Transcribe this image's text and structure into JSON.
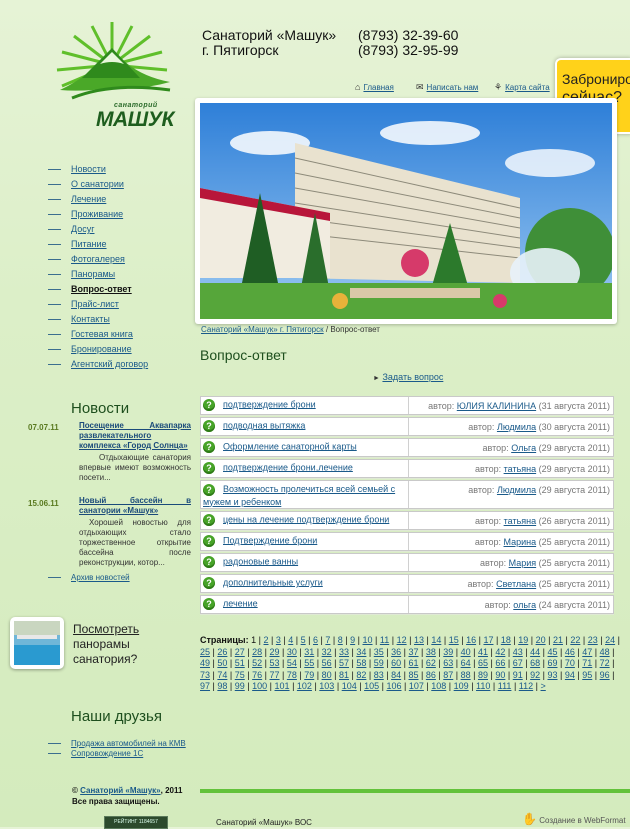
{
  "colors": {
    "accent_green": "#47a328",
    "link": "#1a5a8a",
    "badge": "#ffd21a"
  },
  "logo": {
    "small": "санаторий",
    "big": "МАШУК"
  },
  "header": {
    "name": "Санаторий «Машук»",
    "city": "г. Пятигорск",
    "phone1": "(8793) 32-39-60",
    "phone2": "(8793) 32-95-99"
  },
  "topnav": [
    {
      "label": "Главная",
      "icon": "home-icon"
    },
    {
      "label": "Написать нам",
      "icon": "envelope-icon"
    },
    {
      "label": "Карта сайта",
      "icon": "sitemap-icon"
    }
  ],
  "booking": {
    "line1": "Забронировать",
    "line2": "сейчас?"
  },
  "nav": [
    {
      "label": "Новости"
    },
    {
      "label": "О санатории"
    },
    {
      "label": "Лечение"
    },
    {
      "label": "Проживание"
    },
    {
      "label": "Досуг"
    },
    {
      "label": "Питание"
    },
    {
      "label": "Фотогалерея"
    },
    {
      "label": "Панорамы"
    },
    {
      "label": "Вопрос-ответ",
      "active": true
    },
    {
      "label": "Прайс-лист"
    },
    {
      "label": "Контакты"
    },
    {
      "label": "Гостевая книга"
    },
    {
      "label": "Бронирование"
    },
    {
      "label": "Агентский договор"
    }
  ],
  "news": {
    "heading": "Новости",
    "items": [
      {
        "date": "07.07.11",
        "title": "Посещение Аквапарка развлекательного комплекса «Город Солнца»",
        "text": "Отдыхающие санатория впервые имеют возможность посети..."
      },
      {
        "date": "15.06.11",
        "title": "Новый бассейн в санатории «Машук»",
        "text": "Хорошей новостью для отдыхающих стало торжественное открытие бассейна после реконструкции, котор..."
      }
    ],
    "archive": "Архив новостей"
  },
  "panorama": {
    "line1": "Посмотреть",
    "line2": "панорамы",
    "line3": "санатория?"
  },
  "friends": {
    "heading": "Наши друзья",
    "items": [
      "Продажа автомобилей на КМВ",
      "Сопровождение 1С"
    ]
  },
  "breadcrumb": {
    "home": "Санаторий «Машук» г. Пятигорск",
    "sep": "/",
    "current": "Вопрос-ответ"
  },
  "page_title": "Вопрос-ответ",
  "ask_link": "Задать вопрос",
  "author_prefix": "автор:",
  "questions": [
    {
      "q": "подтверждение брони",
      "author": "ЮЛИЯ КАЛИНИНА",
      "date": "(31 августа 2011)"
    },
    {
      "q": "подводная вытяжка",
      "author": "Людмила",
      "date": "(30 августа 2011)"
    },
    {
      "q": "Оформление санаторной карты",
      "author": "Ольга",
      "date": "(29 августа 2011)"
    },
    {
      "q": "подтверждение брони,лечение",
      "author": "татьяна",
      "date": "(29 августа 2011)"
    },
    {
      "q": "Возможность пролечиться всей семьей с мужем и ребенком",
      "author": "Людмила",
      "date": "(29 августа 2011)"
    },
    {
      "q": "цены на лечение подтверждение брони",
      "author": "татьяна",
      "date": "(26 августа 2011)"
    },
    {
      "q": "Подтверждение брони",
      "author": "Марина",
      "date": "(25 августа 2011)"
    },
    {
      "q": "радоновые ванны",
      "author": "Мария",
      "date": "(25 августа 2011)"
    },
    {
      "q": "дополнительные услуги",
      "author": "Светлана",
      "date": "(25 августа 2011)"
    },
    {
      "q": "лечение",
      "author": "ольга",
      "date": "(24 августа 2011)"
    }
  ],
  "pager": {
    "label": "Страницы:",
    "current": "1",
    "last_page": 112,
    "next": ">"
  },
  "footer": {
    "copyright": "Санаторий «Машук»",
    "year": ", 2011",
    "prefix": "©",
    "rights": "Все права защищены.",
    "counter": "РЕЙТИНГ 1184657",
    "center": "Санаторий «Машук» ВОС",
    "maker": "Создание в WebFormat"
  }
}
